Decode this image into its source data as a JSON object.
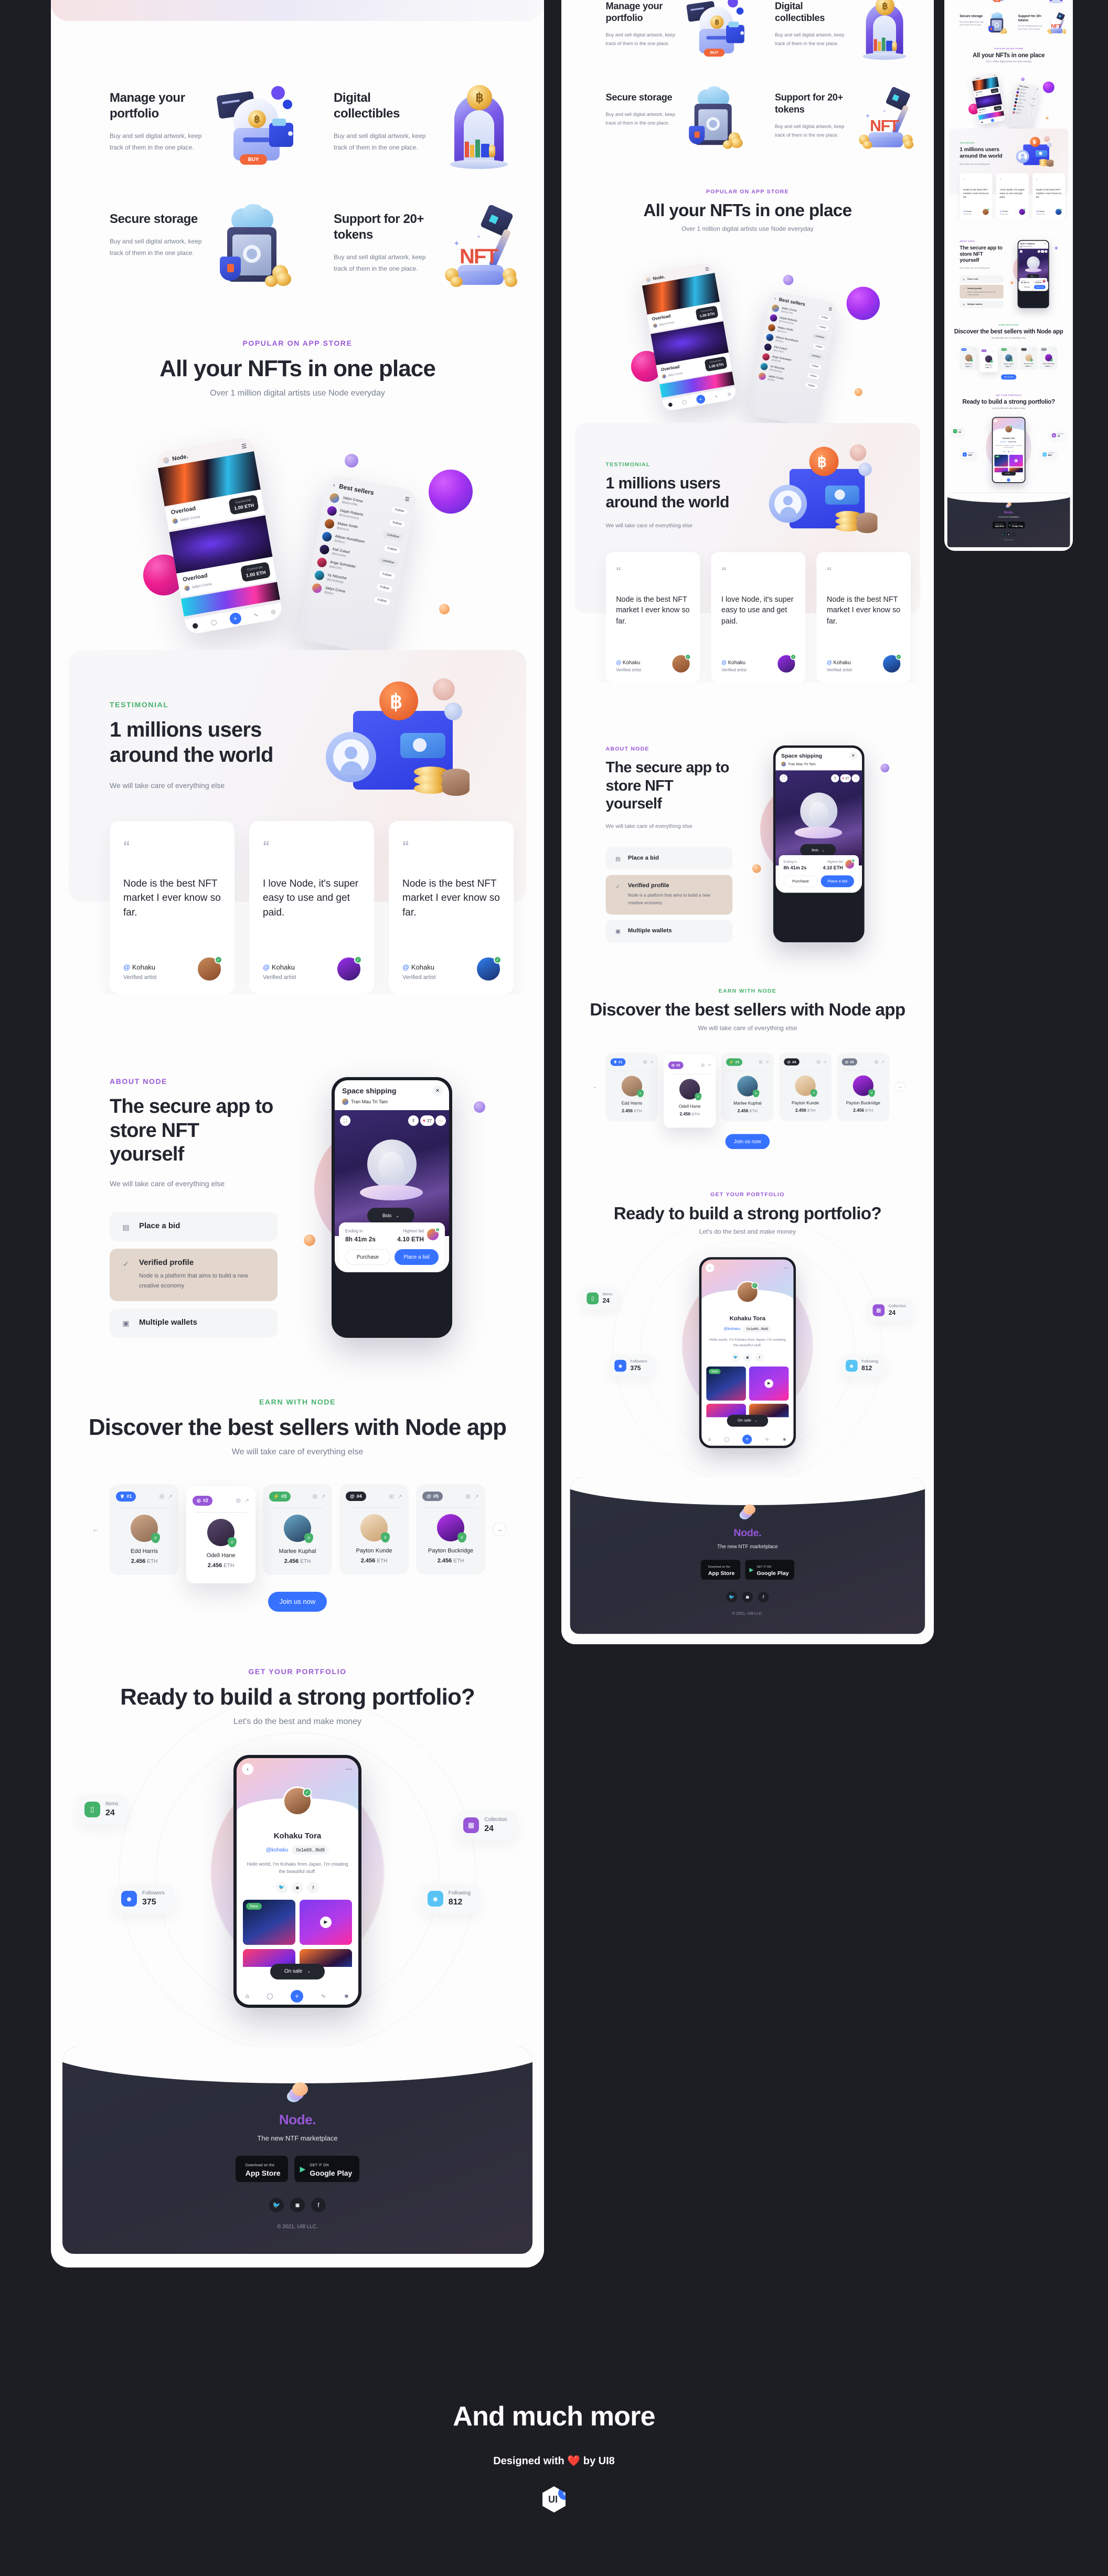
{
  "features": [
    {
      "title": "Manage your portfolio",
      "desc": "Buy and sell digital artwork, keep track of them in the one place.",
      "art": "wallet-buy-art"
    },
    {
      "title": "Digital collectibles",
      "desc": "Buy and sell digital artwork, keep track of them in the one place.",
      "art": "collectibles-arch-art"
    },
    {
      "title": "Secure storage",
      "desc": "Buy and sell digital artwork, keep track of them in the one place.",
      "art": "safe-cloud-art"
    },
    {
      "title": "Support for 20+ tokens",
      "desc": "Buy and sell digital artwork, keep track of them in the one place.",
      "art": "nft-hammer-art"
    }
  ],
  "nfts_section": {
    "eyebrow": "POPULAR ON APP STORE",
    "title": "All your NFTs in one place",
    "subtitle": "Over 1 million digital artists use Node everyday",
    "phone_app": {
      "brand": "Node.",
      "items": [
        {
          "name": "Overload",
          "bid_label": "Current bid",
          "bid_value": "1.00 ETH",
          "author": "Jailyn Crona"
        },
        {
          "name": "Overload",
          "bid_label": "Current bid",
          "bid_value": "1.00 ETH",
          "author": "Jailyn Crona"
        }
      ]
    },
    "sellers_phone": {
      "title": "Best sellers",
      "rows": [
        {
          "name": "Jailyn Crona",
          "handle": "@jailyn1599",
          "action": "Follow"
        },
        {
          "name": "Dejah Roberts",
          "handle": "@randomname",
          "action": "Follow"
        },
        {
          "name": "Mateo Smith",
          "handle": "@ghesult",
          "action": "Unfollow"
        },
        {
          "name": "Allison Runolfsson",
          "handle": "@allison",
          "action": "Follow"
        },
        {
          "name": "Kiel Zulauf",
          "handle": "@kiomaker",
          "action": "Unfollow"
        },
        {
          "name": "Ange Schneider",
          "handle": "@ak2200",
          "action": "Follow"
        },
        {
          "name": "Vy Nitzsche",
          "handle": "@pollydesign",
          "action": "Follow"
        },
        {
          "name": "Jailyn Crona",
          "handle": "@jailyn",
          "action": "Follow"
        }
      ]
    }
  },
  "testimonial": {
    "eyebrow": "TESTIMONIAL",
    "title": "1 millions users around the world",
    "subtitle": "We will take care of everything else",
    "cards": [
      {
        "quote": "Node is the best NFT market I ever know so far.",
        "handle": "Kohaku",
        "role": "Verified artist"
      },
      {
        "quote": "I love Node, it's super easy to use and get paid.",
        "handle": "Kohaku",
        "role": "Verified artist"
      },
      {
        "quote": "Node is the best NFT market I ever know so far.",
        "handle": "Kohaku",
        "role": "Verified artist"
      }
    ]
  },
  "about": {
    "eyebrow": "ABOUT NODE",
    "title": "The secure app to store NFT yourself",
    "subtitle": "We will take care of everything else",
    "options": [
      {
        "title": "Place a bid",
        "desc": "",
        "active": false,
        "icon": "card-icon"
      },
      {
        "title": "Verified profile",
        "desc": "Node is a platform that aims to build a new creative economy",
        "active": true,
        "icon": "check-icon"
      },
      {
        "title": "Multiple wallets",
        "desc": "",
        "active": false,
        "icon": "wallet-icon"
      }
    ],
    "phone": {
      "title": "Space shipping",
      "author": "Tran Mau Tri Tam",
      "likes": "27",
      "bids_label": "Bids",
      "ending_label": "Ending in",
      "ending_value": "8h 41m 2s",
      "highest_label": "Highest bid",
      "highest_value": "4.10 ETH",
      "purchase_label": "Purchase",
      "bid_label": "Place a bid"
    }
  },
  "sellers": {
    "eyebrow": "EARN WITH NODE",
    "title": "Discover the best sellers with Node app",
    "subtitle": "We will take care of everything else",
    "cta": "Join us now",
    "cards": [
      {
        "rank": "#1",
        "rank_icon": "trophy-icon",
        "name": "Edd Harris",
        "price": "2.456",
        "currency": "ETH"
      },
      {
        "rank": "#2",
        "rank_icon": "target-icon",
        "name": "Odell Hane",
        "price": "2.456",
        "currency": "ETH"
      },
      {
        "rank": "#3",
        "rank_icon": "bolt-icon",
        "name": "Marlee Kuphal",
        "price": "2.456",
        "currency": "ETH"
      },
      {
        "rank": "#4",
        "rank_icon": "at-icon",
        "name": "Payton Kunde",
        "price": "2.456",
        "currency": "ETH"
      },
      {
        "rank": "#5",
        "rank_icon": "at-icon",
        "name": "Payton Buckridge",
        "price": "2.456",
        "currency": "ETH"
      }
    ]
  },
  "portfolio": {
    "eyebrow": "GET YOUR PORTFOLIO",
    "title": "Ready to build a strong portfolio?",
    "subtitle": "Let's do the best and make money",
    "profile": {
      "name": "Kohaku Tora",
      "handle": "@kohaku",
      "address": "0x1e69...f6d9",
      "bio": "Hello world, I'm Kohaku from Japan. I'm creating the beautiful stuff.",
      "new_badge": "New",
      "filter": "On sale"
    },
    "stats": [
      {
        "label": "Items",
        "value": "24",
        "color": "#45b26b",
        "icon": "box-icon"
      },
      {
        "label": "Followers",
        "value": "375",
        "color": "#3772ff",
        "icon": "user-icon"
      },
      {
        "label": "Collection",
        "value": "24",
        "color": "#9757d7",
        "icon": "grid-icon"
      },
      {
        "label": "Following",
        "value": "812",
        "color": "#58c4f6",
        "icon": "user-icon"
      }
    ]
  },
  "footer": {
    "brand": "Node",
    "brand_dot": ".",
    "tagline": "The new NTF marketplace",
    "stores": [
      {
        "small": "Download on the",
        "big": "App Store",
        "icon": "apple-icon"
      },
      {
        "small": "GET IT ON",
        "big": "Google Play",
        "icon": "play-icon"
      }
    ],
    "socials": [
      "twitter-icon",
      "instagram-icon",
      "facebook-icon"
    ],
    "copyright": "© 2021, UI8 LLC."
  },
  "banner": {
    "title": "And much more",
    "credit_pre": "Designed with ",
    "credit_heart": "❤️",
    "credit_post": " by UI8",
    "logo_text": "UI",
    "logo_badge": "8"
  },
  "colors": {
    "purple": "#9757d7",
    "green": "#45b26b",
    "blue": "#3772ff",
    "dark": "#23262f",
    "gray": "#777e90",
    "page_bg": "#1d1e24"
  }
}
